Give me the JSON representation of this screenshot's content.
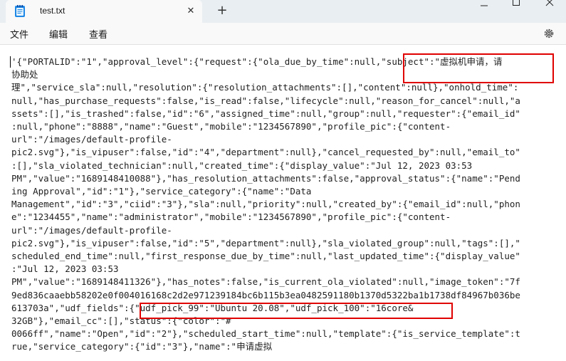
{
  "window": {
    "tab_title": "test.txt",
    "tab_close": "✕",
    "new_tab": "+"
  },
  "menu": {
    "file": "文件",
    "edit": "编辑",
    "view": "查看"
  },
  "icons": {
    "app": "notepad-icon",
    "settings": "gear-icon",
    "minimize": "minimize-icon",
    "maximize": "maximize-icon",
    "close": "close-icon"
  },
  "document": {
    "lines": [
      "'{\"PORTALID\":\"1\",\"approval_level\":{\"request\":{\"ola_due_by_time\":null,\"subject\":\"虚拟机申请，请",
      "协助处",
      "理\",\"service_sla\":null,\"resolution\":{\"resolution_attachments\":[],\"content\":null},\"onhold_time\":",
      "null,\"has_purchase_requests\":false,\"is_read\":false,\"lifecycle\":null,\"reason_for_cancel\":null,\"a",
      "ssets\":[],\"is_trashed\":false,\"id\":\"6\",\"assigned_time\":null,\"group\":null,\"requester\":{\"email_id\"",
      ":null,\"phone\":\"8888\",\"name\":\"Guest\",\"mobile\":\"1234567890\",\"profile_pic\":{\"content-",
      "url\":\"/images/default-profile-",
      "pic2.svg\"},\"is_vipuser\":false,\"id\":\"4\",\"department\":null},\"cancel_requested_by\":null,\"email_to\"",
      ":[],\"sla_violated_technician\":null,\"created_time\":{\"display_value\":\"Jul 12, 2023 03:53",
      "PM\",\"value\":\"1689148410088\"},\"has_resolution_attachments\":false,\"approval_status\":{\"name\":\"Pend",
      "ing Approval\",\"id\":\"1\"},\"service_category\":{\"name\":\"Data",
      "Management\",\"id\":\"3\",\"ciid\":\"3\"},\"sla\":null,\"priority\":null,\"created_by\":{\"email_id\":null,\"phon",
      "e\":\"1234455\",\"name\":\"administrator\",\"mobile\":\"1234567890\",\"profile_pic\":{\"content-",
      "url\":\"/images/default-profile-",
      "pic2.svg\"},\"is_vipuser\":false,\"id\":\"5\",\"department\":null},\"sla_violated_group\":null,\"tags\":[],\"",
      "scheduled_end_time\":null,\"first_response_due_by_time\":null,\"last_updated_time\":{\"display_value\"",
      ":\"Jul 12, 2023 03:53",
      "PM\",\"value\":\"1689148411326\"},\"has_notes\":false,\"is_current_ola_violated\":null,\"image_token\":\"7f",
      "9ed836caaebb58202e0f004016168c2d2e971239184bc6b115b3ea0482591180b1370d5322ba1b1738df84967b036be",
      "613703a\",\"udf_fields\":{\"udf_pick_99\":\"Ubuntu 20.08\",\"udf_pick_100\":\"16core&",
      "32GB\"},\"email_cc\":[],\"status\":{\"color\":\"#",
      "0066ff\",\"name\":\"Open\",\"id\":\"2\"},\"scheduled_start_time\":null,\"template\":{\"is_service_template\":t",
      "rue,\"service_category\":{\"id\":\"3\"},\"name\":\"申请虚拟"
    ]
  },
  "annotations": {
    "color": "#e00000"
  }
}
